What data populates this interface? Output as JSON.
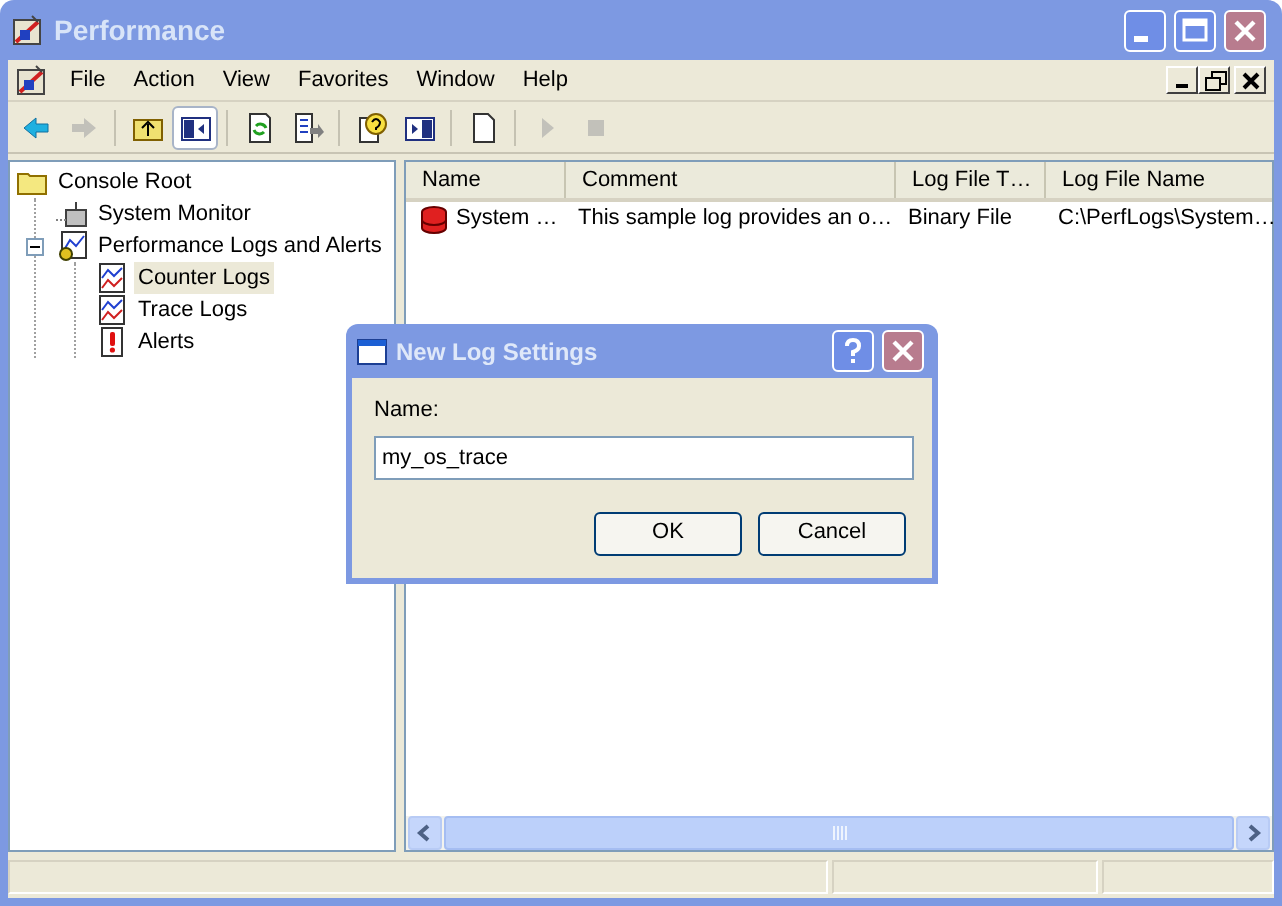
{
  "window": {
    "title": "Performance"
  },
  "menu": [
    "File",
    "Action",
    "View",
    "Favorites",
    "Window",
    "Help"
  ],
  "toolbar": [
    {
      "kind": "back",
      "disabled": false,
      "pressed": false
    },
    {
      "kind": "forward",
      "disabled": true,
      "pressed": false
    },
    {
      "kind": "separator"
    },
    {
      "kind": "up",
      "disabled": false,
      "pressed": false
    },
    {
      "kind": "tree-toggle",
      "disabled": false,
      "pressed": true
    },
    {
      "kind": "separator"
    },
    {
      "kind": "refresh",
      "disabled": false,
      "pressed": false
    },
    {
      "kind": "export",
      "disabled": false,
      "pressed": false
    },
    {
      "kind": "separator"
    },
    {
      "kind": "help",
      "disabled": false,
      "pressed": false
    },
    {
      "kind": "action-pane",
      "disabled": false,
      "pressed": false
    },
    {
      "kind": "separator"
    },
    {
      "kind": "new",
      "disabled": false,
      "pressed": false
    },
    {
      "kind": "separator"
    },
    {
      "kind": "start",
      "disabled": true,
      "pressed": false
    },
    {
      "kind": "stop",
      "disabled": true,
      "pressed": false
    }
  ],
  "tree": [
    {
      "label": "Console Root",
      "kind": "folder",
      "selected": false,
      "children": [
        {
          "label": "System Monitor",
          "kind": "monitor",
          "selected": false
        },
        {
          "label": "Performance Logs and Alerts",
          "kind": "logs",
          "selected": false,
          "expanded": true,
          "children": [
            {
              "label": "Counter Logs",
              "kind": "chart",
              "selected": true
            },
            {
              "label": "Trace Logs",
              "kind": "chart",
              "selected": false
            },
            {
              "label": "Alerts",
              "kind": "alert",
              "selected": false
            }
          ]
        }
      ]
    }
  ],
  "list": {
    "columns": [
      "Name",
      "Comment",
      "Log File T…",
      "Log File Name"
    ],
    "rows": [
      {
        "kind": "log",
        "cells": [
          "System …",
          "This sample log provides an o…",
          "Binary File",
          "C:\\PerfLogs\\System…"
        ]
      }
    ]
  },
  "dialog": {
    "title": "New Log Settings",
    "field_label": "Name:",
    "value": "my_os_trace",
    "buttons": [
      "OK",
      "Cancel"
    ]
  }
}
